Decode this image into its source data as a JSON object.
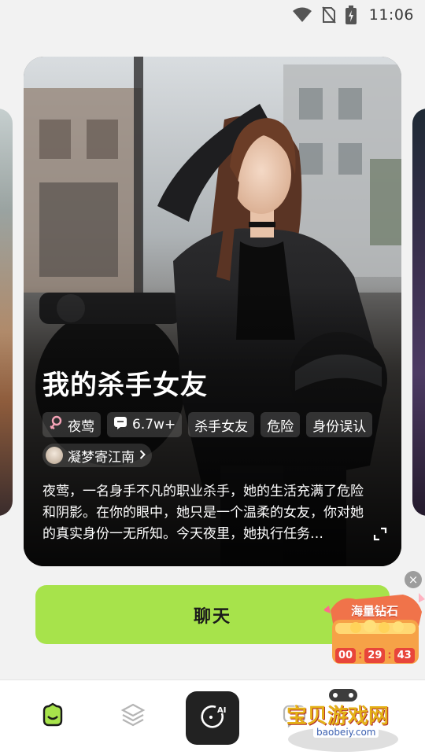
{
  "status_bar": {
    "time": "11:06",
    "icons": [
      "wifi-icon",
      "no-sim-icon",
      "battery-charging-icon"
    ]
  },
  "card": {
    "title": "我的杀手女友",
    "tags": [
      {
        "icon": "female-icon",
        "label": "夜莺"
      },
      {
        "icon": "chat-count-icon",
        "label": "6.7w+"
      },
      {
        "label": "杀手女友"
      },
      {
        "label": "危险"
      },
      {
        "label": "身份误认"
      }
    ],
    "author": {
      "name": "凝梦寄江南",
      "icon": "chevron-right-icon"
    },
    "description": "夜莺，一名身手不凡的职业杀手，她的生活充满了危险和阴影。在你的眼中，她只是一个温柔的女友，你对她的真实身份一无所知。今天夜里，她执行任务…"
  },
  "chat_button": {
    "label": "聊天"
  },
  "promo": {
    "label": "海量钻石",
    "timer": [
      "00",
      "29",
      "43"
    ]
  },
  "bottom_nav": {
    "items": [
      {
        "name": "home",
        "icon": "home-face-icon",
        "active": true
      },
      {
        "name": "discover",
        "icon": "layers-icon",
        "active": false
      },
      {
        "name": "create",
        "icon": "ai-create-icon",
        "active": false
      },
      {
        "name": "messages",
        "icon": "message-icon",
        "active": false
      }
    ]
  },
  "watermark": {
    "text": "宝贝游戏网",
    "url": "baobeiy.com"
  },
  "colors": {
    "accent": "#a7e34b",
    "background": "#f2f2f2",
    "nav_background": "#ffffff",
    "center_button": "#222222",
    "timer_red": "#e8453a"
  }
}
